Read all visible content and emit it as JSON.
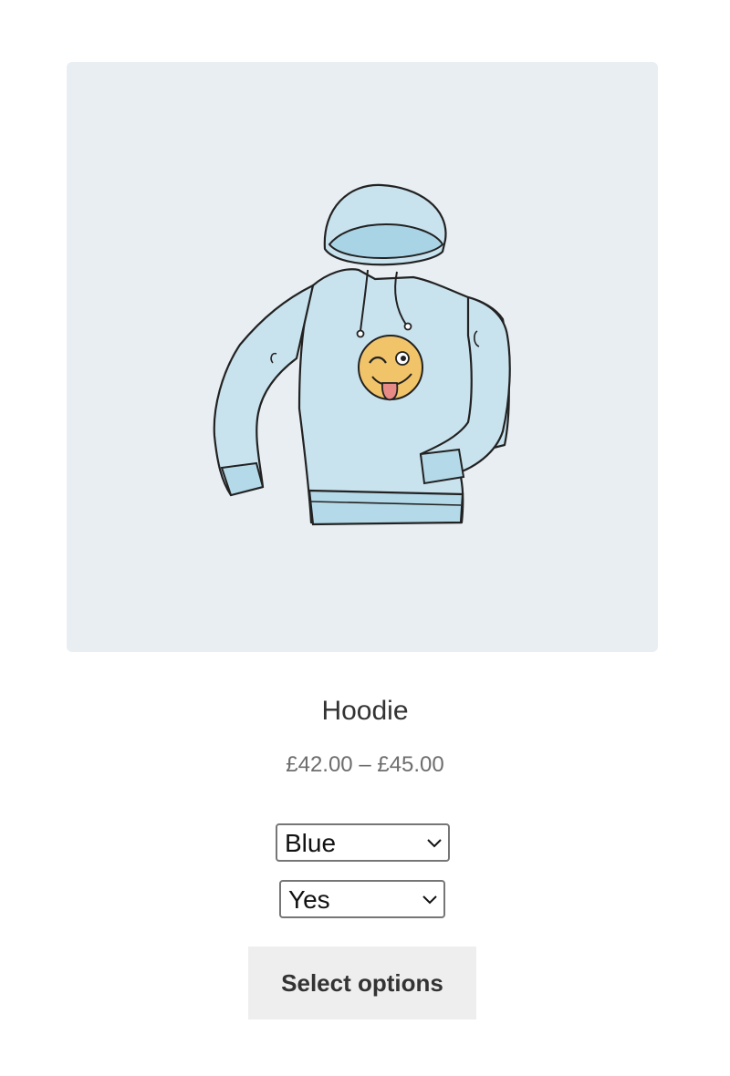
{
  "product": {
    "title": "Hoodie",
    "price": "£42.00 – £45.00",
    "image_icon": "hoodie-with-winking-emoji",
    "image_background": "#e9eef3",
    "hoodie_color": "#c9e3ee"
  },
  "variations": {
    "color": {
      "selected": "Blue"
    },
    "logo": {
      "selected": "Yes"
    }
  },
  "actions": {
    "select_options_label": "Select options"
  }
}
